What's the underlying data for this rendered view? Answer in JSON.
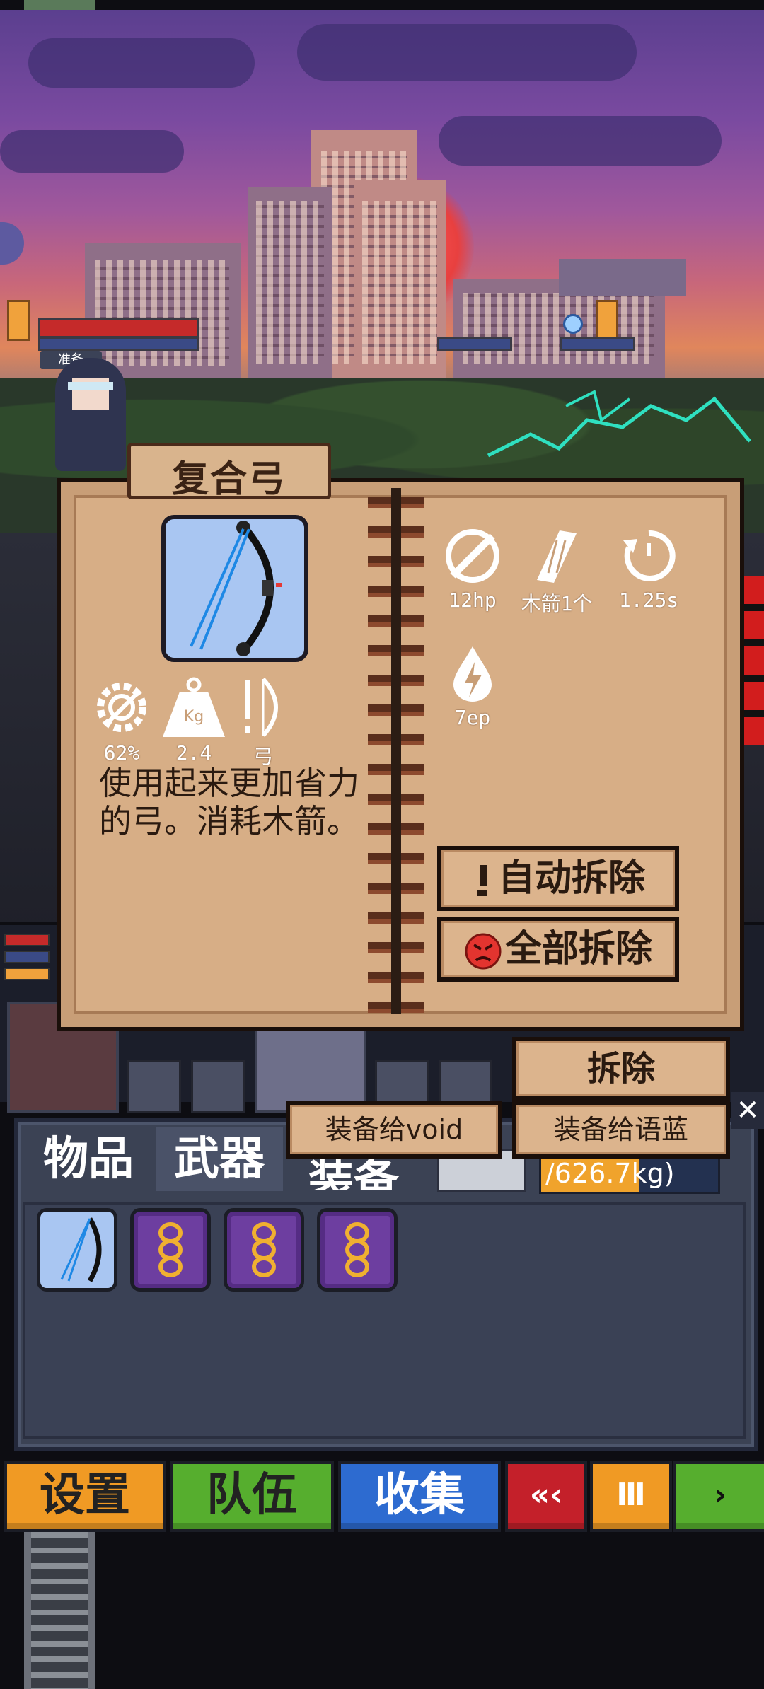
{
  "scene": {
    "status_tag": "准备",
    "colors": {
      "sky_top": "#5b3f8f",
      "sun": "#e8403f",
      "hp_red": "#c52a2a",
      "lightning": "#2fe0c0"
    }
  },
  "panel": {
    "title": "复合弓",
    "weapon_icon": "compound-bow-icon",
    "stats_right": [
      {
        "icon": "damage-icon",
        "label": "12hp"
      },
      {
        "icon": "ammo-icon",
        "label": "木箭1个"
      },
      {
        "icon": "cooldown-icon",
        "label": "1.25s"
      },
      {
        "icon": "energy-icon",
        "label": "7ep"
      }
    ],
    "stats_left": [
      {
        "icon": "durability-gear-icon",
        "label": "62%"
      },
      {
        "icon": "weight-icon",
        "label": "2.4"
      },
      {
        "icon": "bow-type-icon",
        "label": "弓"
      }
    ],
    "weight_glyph": "Kg",
    "description": "使用起来更加省力的弓。消耗木箭。",
    "auto_dismantle_label": "自动拆除",
    "dismantle_all_label": "全部拆除",
    "dismantle_label": "拆除",
    "equip_void_label": "装备给void",
    "equip_yulan_label": "装备给语蓝",
    "close_symbol": "✕"
  },
  "inventory": {
    "tabs": [
      "物品",
      "武器",
      "装备"
    ],
    "weight_text": "/626.7kg)",
    "weight_fill": 0.55,
    "slots": [
      {
        "icon": "compound-bow-icon",
        "kind": "bow"
      },
      {
        "icon": "chain-ring-icon",
        "kind": "ring"
      },
      {
        "icon": "chain-ring-icon",
        "kind": "ring"
      },
      {
        "icon": "chain-ring-icon",
        "kind": "ring"
      }
    ]
  },
  "menu": {
    "settings": "设置",
    "team": "队伍",
    "collect": "收集",
    "rewind": "«‹",
    "pause": "Ⅲ",
    "play": "›",
    "colors": {
      "orange": "#f09a24",
      "green": "#56ae2e",
      "blue": "#2d6bd0",
      "red": "#c4202a"
    }
  }
}
